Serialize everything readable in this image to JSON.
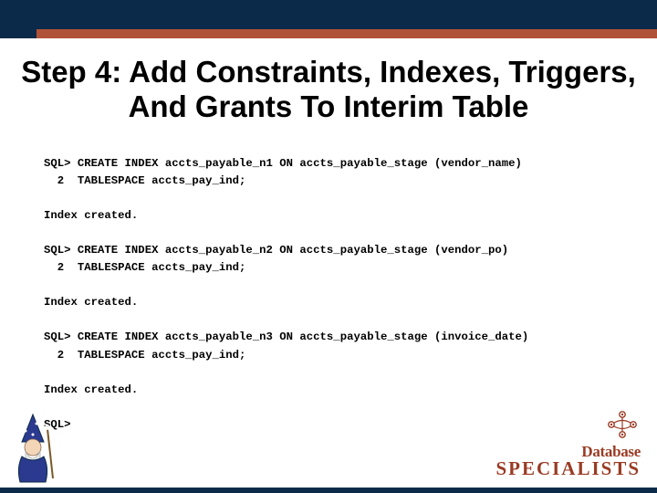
{
  "slide": {
    "title": "Step 4: Add Constraints, Indexes, Triggers, And Grants To Interim Table"
  },
  "code": {
    "l1": "SQL> CREATE INDEX accts_payable_n1 ON accts_payable_stage (vendor_name)",
    "l2": "  2  TABLESPACE accts_pay_ind;",
    "l3": "",
    "l4": "Index created.",
    "l5": "",
    "l6": "SQL> CREATE INDEX accts_payable_n2 ON accts_payable_stage (vendor_po)",
    "l7": "  2  TABLESPACE accts_pay_ind;",
    "l8": "",
    "l9": "Index created.",
    "l10": "",
    "l11": "SQL> CREATE INDEX accts_payable_n3 ON accts_payable_stage (invoice_date)",
    "l12": "  2  TABLESPACE accts_pay_ind;",
    "l13": "",
    "l14": "Index created.",
    "l15": "",
    "l16": "SQL>"
  },
  "logo": {
    "line1": "Database",
    "line2": "SPECIALISTS"
  }
}
